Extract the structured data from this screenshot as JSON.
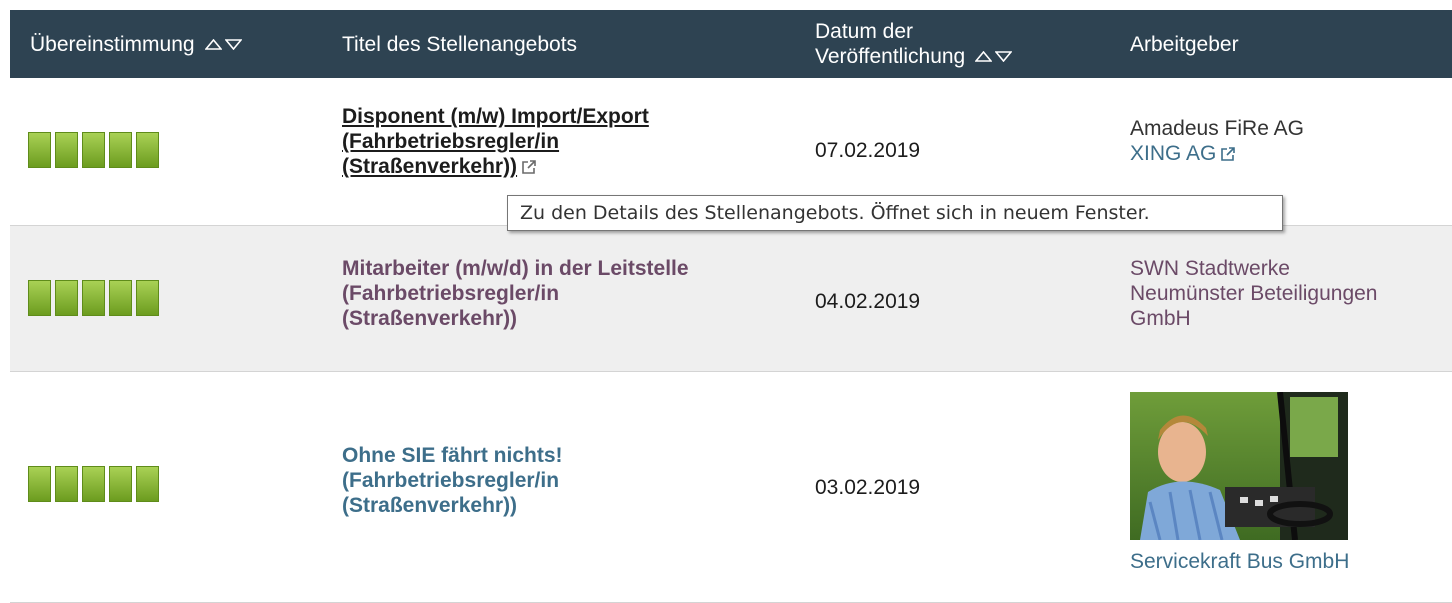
{
  "header": {
    "match": "Übereinstimmung",
    "title": "Titel des Stellenangebots",
    "date_line1": "Datum der",
    "date_line2": "Veröffentlichung",
    "employer": "Arbeitgeber"
  },
  "rows": [
    {
      "rating": 5,
      "title_lines": [
        "Disponent (m/w) Import/Export",
        "(Fahrbetriebsregler/in",
        "(Straßenverkehr))"
      ],
      "date": "07.02.2019",
      "employer_lines": [
        "Amadeus FiRe AG"
      ],
      "employer_link": "XING AG"
    },
    {
      "rating": 5,
      "title_lines": [
        "Mitarbeiter (m/w/d) in der Leitstelle",
        "(Fahrbetriebsregler/in",
        "(Straßenverkehr))"
      ],
      "date": "04.02.2019",
      "employer_lines": [
        "SWN Stadtwerke",
        "Neumünster Beteiligungen",
        "GmbH"
      ]
    },
    {
      "rating": 5,
      "title_lines": [
        "Ohne SIE fährt nichts!",
        "(Fahrbetriebsregler/in",
        "(Straßenverkehr))"
      ],
      "date": "03.02.2019",
      "employer_lines": [
        "Servicekraft Bus GmbH"
      ]
    }
  ],
  "tooltip": "Zu den Details des Stellenangebots. Öffnet sich in neuem Fenster.",
  "colors": {
    "header_bg": "#2e4352",
    "rating_green": "#7fb12e",
    "link_teal": "#3d6e8a",
    "visited_plum": "#6b4a67",
    "row_alt_bg": "#efefef"
  }
}
